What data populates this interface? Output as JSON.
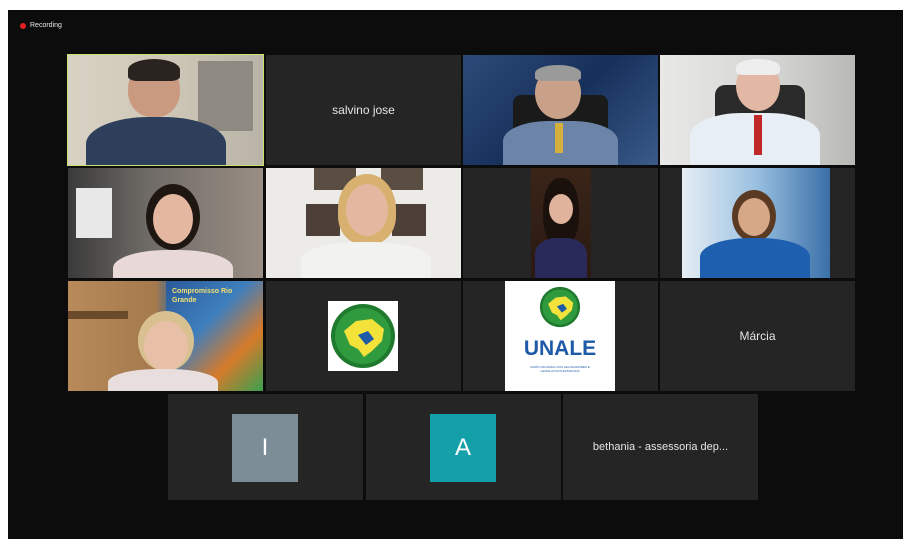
{
  "recording": {
    "label": "Recording",
    "color": "#e02020"
  },
  "participants": [
    {
      "name": "salvino jose"
    },
    {
      "name": "Márcia"
    },
    {
      "name": "bethania - assessoria dep..."
    },
    {
      "initial": "I",
      "avatar_color": "#7d8d98"
    },
    {
      "initial": "A",
      "avatar_color": "#14a0a8"
    }
  ],
  "logos": {
    "unale": {
      "title": "UNALE",
      "subtitle": "UNIÃO NACIONAL DOS LEGISLADORES E LEGISLATIVOS ESTADUAIS"
    },
    "banner_text": "Compromisso Rio Grande"
  },
  "colors": {
    "active_speaker_border": "#c9e06a",
    "tile_bg": "#252525",
    "screen_bg": "#0c0c0c"
  }
}
